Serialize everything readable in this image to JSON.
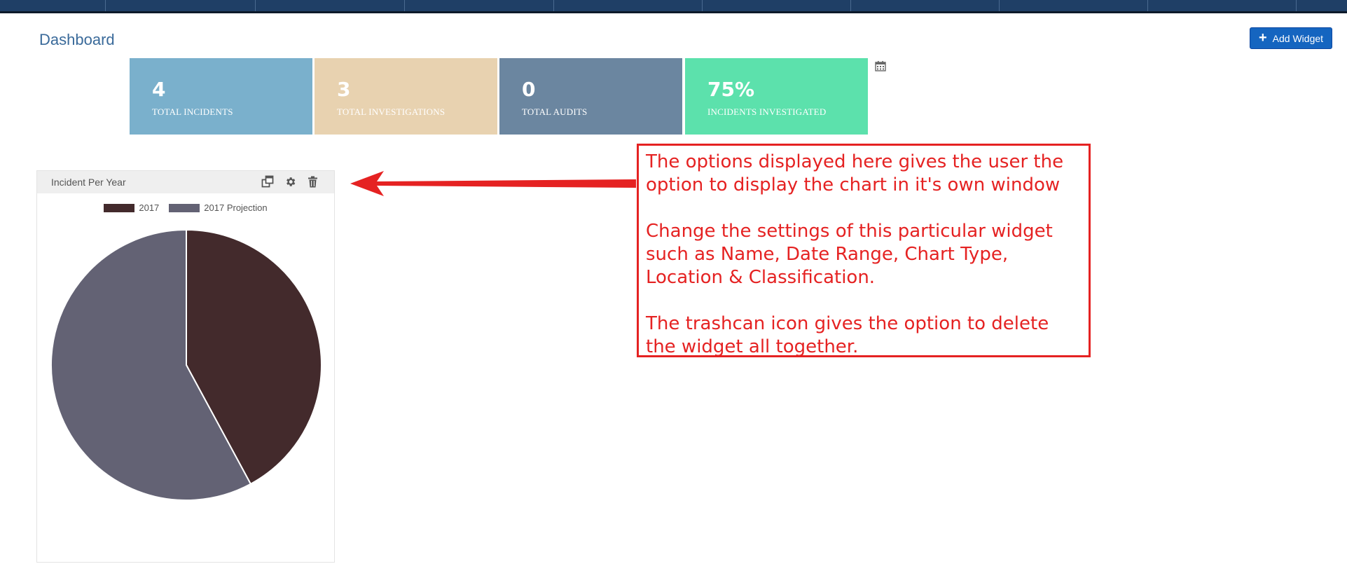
{
  "header": {
    "title": "Dashboard",
    "add_widget_label": "Add Widget"
  },
  "stats": [
    {
      "value": "4",
      "label": "TOTAL INCIDENTS",
      "color": "#7ab0cc"
    },
    {
      "value": "3",
      "label": "TOTAL INVESTIGATIONS",
      "color": "#e8d2b0"
    },
    {
      "value": "0",
      "label": "TOTAL AUDITS",
      "color": "#6b86a0"
    },
    {
      "value": "75%",
      "label": "INCIDENTS INVESTIGATED",
      "color": "#5ce1ac"
    }
  ],
  "widget": {
    "title": "Incident Per Year",
    "tools": [
      "popout-icon",
      "gear-icon",
      "trash-icon"
    ]
  },
  "chart_data": {
    "type": "pie",
    "labels": [
      "2017",
      "2017 Projection"
    ],
    "values": [
      4,
      5.5
    ],
    "colors": [
      "#432a2c",
      "#636274"
    ],
    "legend": "top"
  },
  "annotation": {
    "paragraphs": [
      "The options displayed here gives the user the option to display the chart in it's own window",
      "Change the settings of this particular widget such as Name, Date Range, Chart Type, Location & Classification.",
      "The trashcan icon gives the option to delete the widget all together."
    ],
    "color": "#e52222"
  }
}
